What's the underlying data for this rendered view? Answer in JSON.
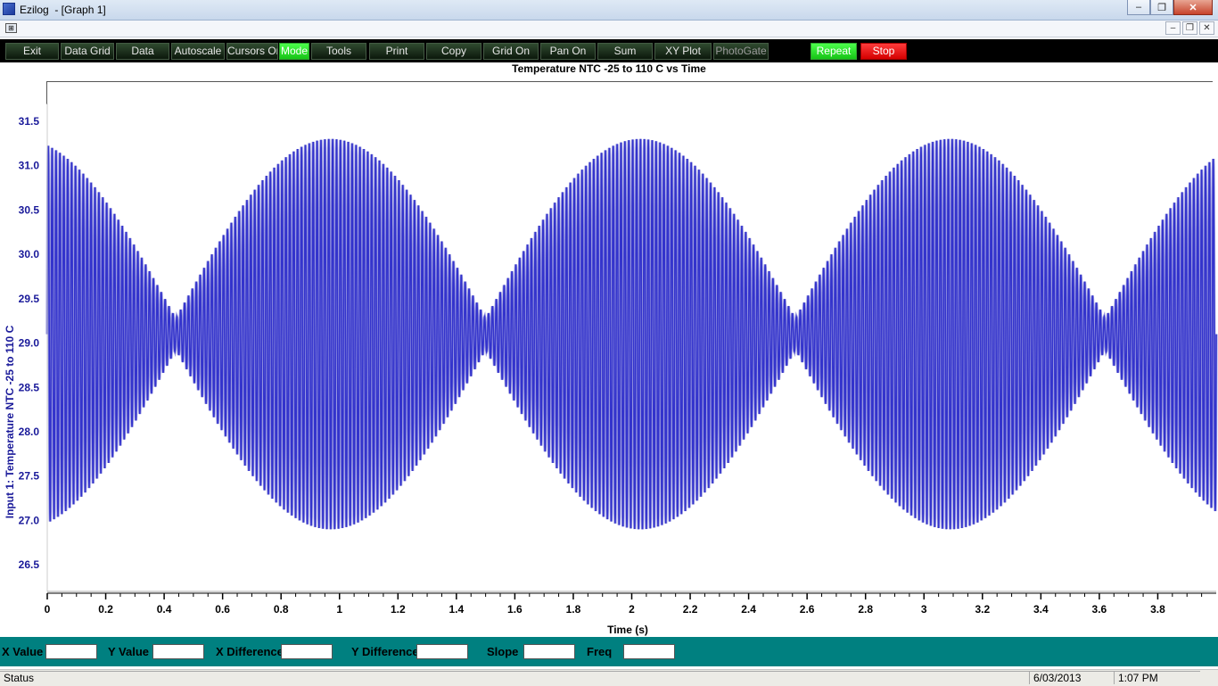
{
  "window": {
    "title": "Ezilog  - [Graph 1]",
    "minimize_glyph": "–",
    "maximize_glyph": "❐",
    "close_glyph": "✕",
    "mdi_icon_glyph": "⊞",
    "mdi_minimize_glyph": "–",
    "mdi_restore_glyph": "❐",
    "mdi_close_glyph": "✕"
  },
  "toolbar": {
    "exit": "Exit",
    "data_grid": "Data Grid",
    "data": "Data",
    "autoscale": "Autoscale",
    "cursors_on": "Cursors On",
    "mode": "Mode",
    "tools": "Tools",
    "print": "Print",
    "copy": "Copy",
    "grid_on": "Grid On",
    "pan_on": "Pan On",
    "sum": "Sum",
    "xy_plot": "XY Plot",
    "photogate": "PhotoGate",
    "repeat": "Repeat",
    "stop": "Stop"
  },
  "colors": {
    "series": "#3333cc",
    "toolbar_active": "#33dd33",
    "stop": "#ee1111",
    "panel": "#008080"
  },
  "chart_data": {
    "type": "line",
    "title": "Temperature NTC -25 to 110 C vs Time",
    "xlabel": "Time (s)",
    "ylabel": "Input 1: Temperature NTC -25 to 110 C",
    "xlim": [
      0,
      4.0
    ],
    "ylim": [
      26.2,
      31.7
    ],
    "xticks": [
      "0",
      "0.2",
      "0.4",
      "0.6",
      "0.8",
      "1",
      "1.2",
      "1.4",
      "1.6",
      "1.8",
      "2",
      "2.2",
      "2.4",
      "2.6",
      "2.8",
      "3",
      "3.2",
      "3.4",
      "3.6",
      "3.8"
    ],
    "yticks": [
      "26.5",
      "27.0",
      "27.5",
      "28.0",
      "28.5",
      "29.0",
      "29.5",
      "30.0",
      "30.5",
      "31.0",
      "31.5"
    ],
    "series": [
      {
        "baseline": 29.1,
        "peak_amplitude": 2.2,
        "carrier_hz": 75,
        "envelope_hz": 0.94,
        "node_times_s": [
          0.44,
          1.5,
          2.56,
          3.62
        ],
        "antinode_times_s": [
          0.97,
          2.03,
          3.09
        ]
      }
    ]
  },
  "readouts": {
    "x_value_label": "X Value",
    "x_value": "",
    "y_value_label": "Y Value",
    "y_value": "",
    "x_diff_label": "X Difference",
    "x_diff": "",
    "y_diff_label": "Y Difference",
    "y_diff": "",
    "slope_label": "Slope",
    "slope": "",
    "freq_label": "Freq",
    "freq": ""
  },
  "status": {
    "label": "Status",
    "date": "6/03/2013",
    "time": "1:07 PM"
  }
}
